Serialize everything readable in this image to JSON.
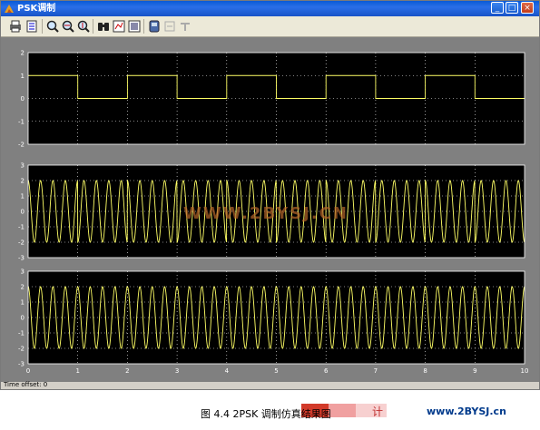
{
  "window": {
    "title": "PSK调制",
    "controls": {
      "minimize": "_",
      "maximize": "□",
      "close": "×"
    }
  },
  "toolbar": {
    "buttons": [
      {
        "icon": "print-icon"
      },
      {
        "icon": "parameters-icon"
      },
      {
        "icon": "zoom-in-icon"
      },
      {
        "icon": "zoom-x-icon"
      },
      {
        "icon": "zoom-y-icon"
      },
      {
        "icon": "autoscale-binoculars-icon"
      },
      {
        "icon": "save-axes-settings-icon"
      },
      {
        "icon": "restore-axes-settings-icon"
      },
      {
        "icon": "floating-scope-icon"
      },
      {
        "icon": "signal-selection-icon"
      },
      {
        "icon": "lock-axes-icon"
      }
    ]
  },
  "colors": {
    "plot_bg": "#000000",
    "trace": "#ffff66",
    "frame_bg": "#808080",
    "grid": "#ffffff"
  },
  "status": {
    "time_offset_label": "Time offset:",
    "time_offset_value": "0"
  },
  "caption": "图 4.4  2PSK 调制仿真结果图",
  "watermark": {
    "url": "www.2BYSJ.cn",
    "logo_text": "计",
    "plot_text": "WWW.2BYSJ.CN"
  },
  "chart_data": [
    {
      "type": "line",
      "title": "",
      "xlim": [
        0,
        10
      ],
      "ylim": [
        -2,
        2
      ],
      "y_ticks": [
        "2",
        "1",
        "0",
        "-1",
        "-2"
      ],
      "grid": true,
      "series": [
        {
          "x": [
            0,
            1,
            1,
            2,
            2,
            3,
            3,
            4,
            4,
            5,
            5,
            6,
            6,
            7,
            7,
            8,
            8,
            9,
            9,
            10
          ],
          "y": [
            1,
            1,
            0,
            0,
            1,
            1,
            0,
            0,
            1,
            1,
            0,
            0,
            1,
            1,
            0,
            0,
            1,
            1,
            0,
            0
          ]
        }
      ]
    },
    {
      "type": "line",
      "title": "",
      "xlim": [
        0,
        10
      ],
      "ylim": [
        -3,
        3
      ],
      "y_ticks": [
        "3",
        "2",
        "1",
        "0",
        "-1",
        "-2",
        "-3"
      ],
      "grid": true,
      "description_of_signal": "2PSK modulated carrier, amplitude 2, phase flips at bit boundaries",
      "carrier_cycles_per_unit": 4,
      "amplitude": 2,
      "bits": [
        1,
        0,
        1,
        0,
        1,
        0,
        1,
        0,
        1,
        0
      ]
    },
    {
      "type": "line",
      "title": "",
      "xlim": [
        0,
        10
      ],
      "ylim": [
        -3,
        3
      ],
      "y_ticks": [
        "3",
        "2",
        "1",
        "0",
        "-1",
        "-2",
        "-3"
      ],
      "x_ticks": [
        "0",
        "1",
        "2",
        "3",
        "4",
        "5",
        "6",
        "7",
        "8",
        "9",
        "10"
      ],
      "grid": true,
      "description_of_signal": "carrier, amplitude 2",
      "carrier_cycles_per_unit": 4,
      "amplitude": 2
    }
  ]
}
